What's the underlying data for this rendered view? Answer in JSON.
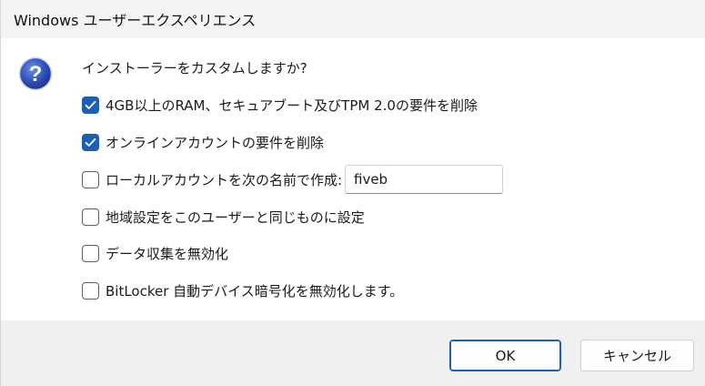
{
  "window": {
    "title": "Windows ユーザーエクスペリエンス"
  },
  "dialog": {
    "prompt": "インストーラーをカスタムしますか?",
    "options": [
      {
        "label": "4GB以上のRAM、セキュアブート及びTPM 2.0の要件を削除",
        "checked": true
      },
      {
        "label": "オンラインアカウントの要件を削除",
        "checked": true
      },
      {
        "label": "ローカルアカウントを次の名前で作成:",
        "checked": false
      },
      {
        "label": "地域設定をこのユーザーと同じものに設定",
        "checked": false
      },
      {
        "label": "データ収集を無効化",
        "checked": false
      },
      {
        "label": "BitLocker 自動デバイス暗号化を無効化します。",
        "checked": false
      }
    ],
    "local_account_name": "fiveb"
  },
  "buttons": {
    "ok": "OK",
    "cancel": "キャンセル"
  },
  "colors": {
    "accent": "#1d5fb3",
    "titlebar": "#f3f3f3",
    "footer": "#f0f0f0"
  },
  "icons": {
    "help": "question-mark-icon",
    "check": "checkmark-icon"
  }
}
